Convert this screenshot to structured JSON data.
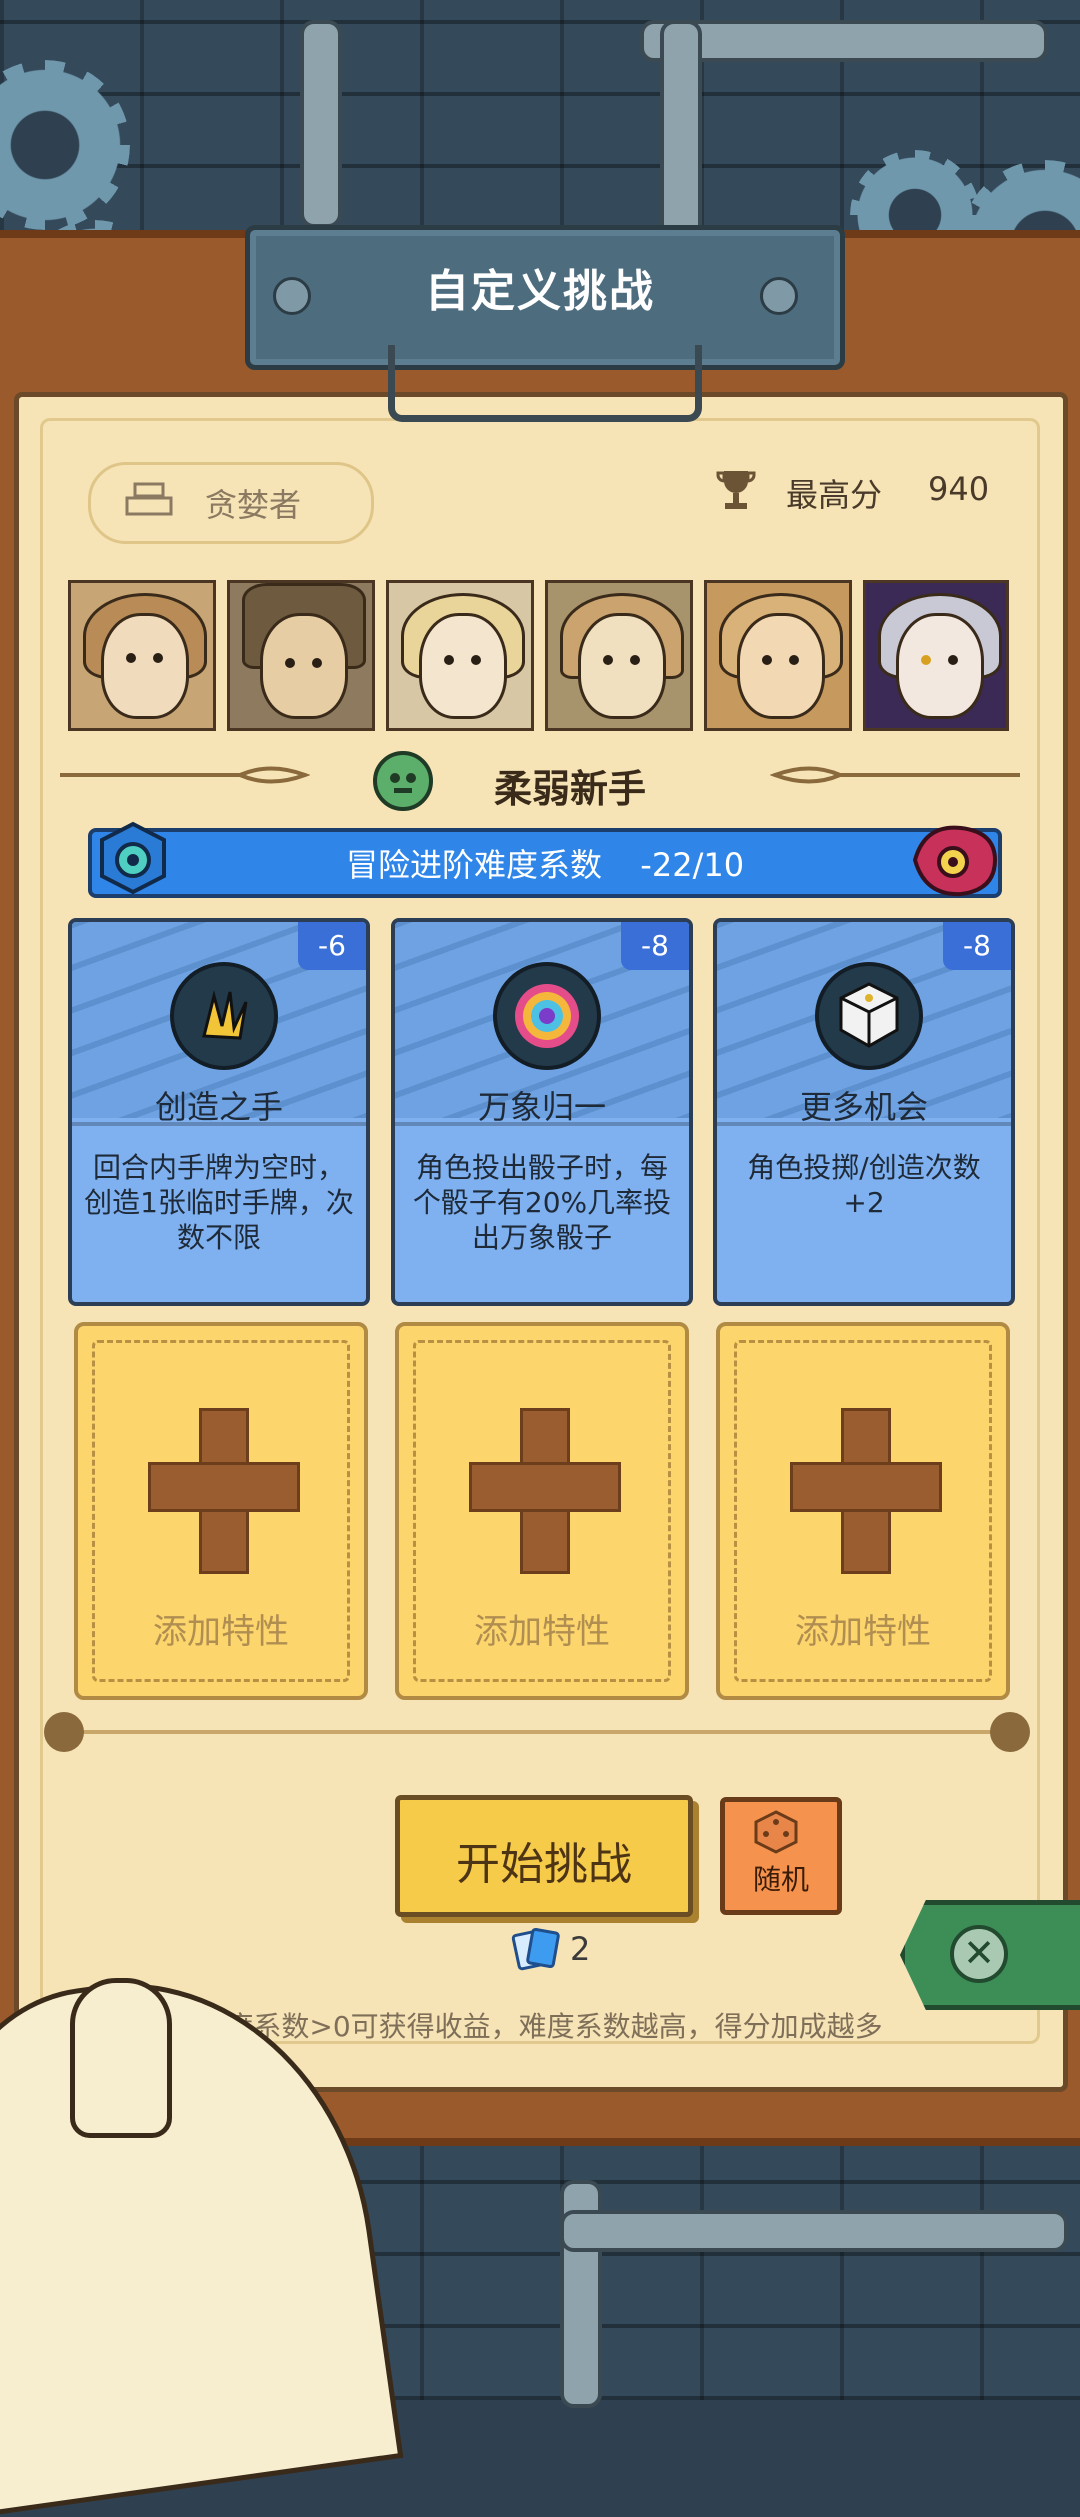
{
  "title": "自定义挑战",
  "player": {
    "name": "贪婪者"
  },
  "best_score": {
    "label": "最高分",
    "value": "940"
  },
  "portraits": [
    "character-1",
    "character-2",
    "character-3",
    "character-4",
    "character-5",
    "character-6"
  ],
  "difficulty": {
    "name": "柔弱新手"
  },
  "progress": {
    "label": "冒险进阶难度系数",
    "value": "-22/10"
  },
  "traits": [
    {
      "badge": "-6",
      "title": "创造之手",
      "desc": "回合内手牌为空时，创造1张临时手牌，次数不限",
      "icon": "yellow-hand-icon"
    },
    {
      "badge": "-8",
      "title": "万象归一",
      "desc": "角色投出骰子时，每个骰子有20%几率投出万象骰子",
      "icon": "rainbow-swirl-icon"
    },
    {
      "badge": "-8",
      "title": "更多机会",
      "desc": "角色投掷/创造次数+2",
      "icon": "dice-cube-icon"
    }
  ],
  "slots": [
    {
      "label": "添加特性"
    },
    {
      "label": "添加特性"
    },
    {
      "label": "添加特性"
    }
  ],
  "buttons": {
    "start": "开始挑战",
    "random": "随机"
  },
  "tickets": {
    "count": "2"
  },
  "hint": "难度系数>0可获得收益，难度系数越高，得分加成越多",
  "colors": {
    "bar": "#2f86e8",
    "card": "#7fb0ef",
    "slot": "#fcd56c",
    "start": "#f6cb4a",
    "random": "#f5924d",
    "close": "#3d8d57"
  }
}
